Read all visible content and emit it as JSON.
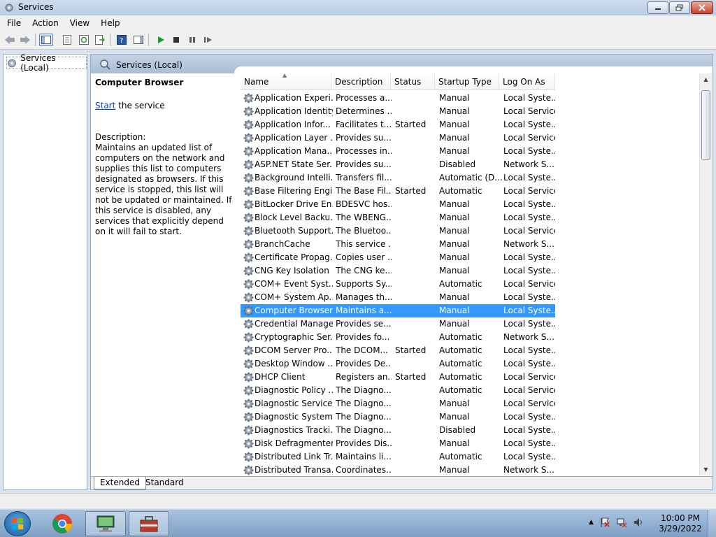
{
  "window": {
    "title": "Services"
  },
  "menu": [
    "File",
    "Action",
    "View",
    "Help"
  ],
  "tree": {
    "root_label": "Services (Local)"
  },
  "pane": {
    "header_title": "Services (Local)",
    "selected_service": "Computer Browser",
    "start_link": "Start",
    "start_suffix": " the service",
    "description_label": "Description:",
    "description_text": "Maintains an updated list of computers on the network and supplies this list to computers designated as browsers. If this service is stopped, this list will not be updated or maintained. If this service is disabled, any services that explicitly depend on it will fail to start."
  },
  "columns": [
    "Name",
    "Description",
    "Status",
    "Startup Type",
    "Log On As"
  ],
  "rows": [
    [
      "Application Experi...",
      "Processes a...",
      "",
      "Manual",
      "Local Syste..."
    ],
    [
      "Application Identity",
      "Determines ...",
      "",
      "Manual",
      "Local Service"
    ],
    [
      "Application Infor...",
      "Facilitates t...",
      "Started",
      "Manual",
      "Local Syste..."
    ],
    [
      "Application Layer ...",
      "Provides su...",
      "",
      "Manual",
      "Local Service"
    ],
    [
      "Application Mana...",
      "Processes in...",
      "",
      "Manual",
      "Local Syste..."
    ],
    [
      "ASP.NET State Ser...",
      "Provides su...",
      "",
      "Disabled",
      "Network S..."
    ],
    [
      "Background Intelli...",
      "Transfers fil...",
      "",
      "Automatic (D...",
      "Local Syste..."
    ],
    [
      "Base Filtering Engi...",
      "The Base Fil...",
      "Started",
      "Automatic",
      "Local Service"
    ],
    [
      "BitLocker Drive En...",
      "BDESVC hos...",
      "",
      "Manual",
      "Local Syste..."
    ],
    [
      "Block Level Backu...",
      "The WBENG...",
      "",
      "Manual",
      "Local Syste..."
    ],
    [
      "Bluetooth Support...",
      "The Bluetoo...",
      "",
      "Manual",
      "Local Service"
    ],
    [
      "BranchCache",
      "This service ...",
      "",
      "Manual",
      "Network S..."
    ],
    [
      "Certificate Propag...",
      "Copies user ...",
      "",
      "Manual",
      "Local Syste..."
    ],
    [
      "CNG Key Isolation",
      "The CNG ke...",
      "",
      "Manual",
      "Local Syste..."
    ],
    [
      "COM+ Event Syst...",
      "Supports Sy...",
      "",
      "Automatic",
      "Local Service"
    ],
    [
      "COM+ System Ap...",
      "Manages th...",
      "",
      "Manual",
      "Local Syste..."
    ],
    [
      "Computer Browser",
      "Maintains a...",
      "",
      "Manual",
      "Local Syste..."
    ],
    [
      "Credential Manager",
      "Provides se...",
      "",
      "Manual",
      "Local Syste..."
    ],
    [
      "Cryptographic Ser...",
      "Provides fo...",
      "",
      "Automatic",
      "Network S..."
    ],
    [
      "DCOM Server Pro...",
      "The DCOM...",
      "Started",
      "Automatic",
      "Local Syste..."
    ],
    [
      "Desktop Window ...",
      "Provides De...",
      "",
      "Automatic",
      "Local Syste..."
    ],
    [
      "DHCP Client",
      "Registers an...",
      "Started",
      "Automatic",
      "Local Service"
    ],
    [
      "Diagnostic Policy ...",
      "The Diagno...",
      "",
      "Automatic",
      "Local Service"
    ],
    [
      "Diagnostic Service...",
      "The Diagno...",
      "",
      "Manual",
      "Local Service"
    ],
    [
      "Diagnostic System...",
      "The Diagno...",
      "",
      "Manual",
      "Local Syste..."
    ],
    [
      "Diagnostics Tracki...",
      "The Diagno...",
      "",
      "Disabled",
      "Local Syste..."
    ],
    [
      "Disk Defragmenter",
      "Provides Dis...",
      "",
      "Manual",
      "Local Syste..."
    ],
    [
      "Distributed Link Tr...",
      "Maintains li...",
      "",
      "Automatic",
      "Local Syste..."
    ],
    [
      "Distributed Transa...",
      "Coordinates...",
      "",
      "Manual",
      "Network S..."
    ]
  ],
  "selected_row_index": 16,
  "bottom_tabs": [
    "Extended",
    "Standard"
  ],
  "clock": {
    "time": "10:00 PM",
    "date": "3/29/2022"
  },
  "colors": {
    "selection": "#3399ff",
    "link": "#0645ad"
  }
}
